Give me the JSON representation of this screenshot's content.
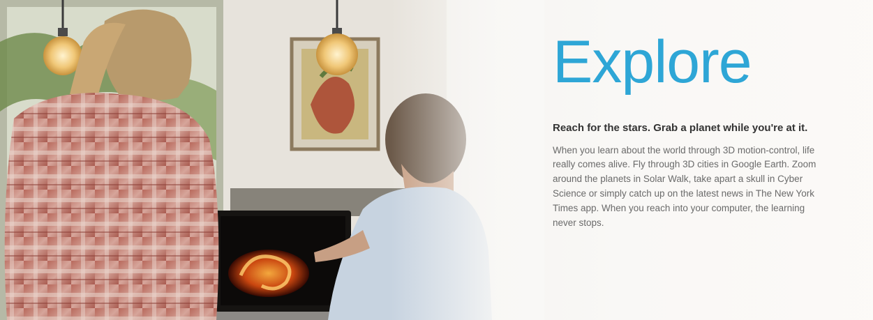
{
  "hero": {
    "title": "Explore",
    "tagline": "Reach for the stars. Grab a planet while you're at it.",
    "body": "When you learn about the world through 3D motion-control, life really comes alive. Fly through 3D cities in Google Earth. Zoom around the planets in Solar Walk, take apart a skull in Cyber Science or simply catch up on the latest news in The New York Times app. When you reach into your computer, the learning never stops.",
    "accent_color": "#2ea6d6"
  }
}
